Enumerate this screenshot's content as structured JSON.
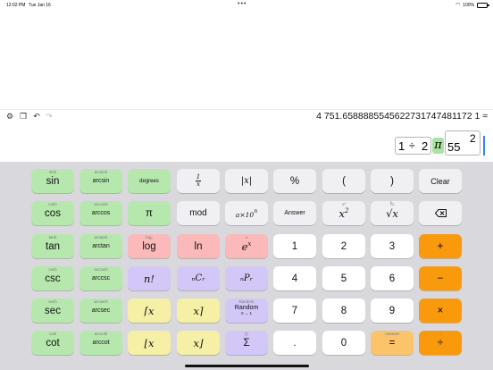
{
  "status_bar": {
    "time": "12:02 PM",
    "date": "Tue Jan 16",
    "battery": "100%"
  },
  "toolbar": {
    "result": "4 751.6588885545622731747481172 1 ≈"
  },
  "expression": {
    "t1": "1",
    "op": "÷",
    "t2": "2",
    "pi": "π",
    "base": "55",
    "exponent": "2"
  },
  "keys": {
    "sin": "sin",
    "sinh": "sinh",
    "arcsin": "arcsin",
    "arcsinh": "arcsinh",
    "cos": "cos",
    "cosh": "cosh",
    "arccos": "arccos",
    "arccosh": "arccosh",
    "tan": "tan",
    "tanh": "tanh",
    "arctan": "arctan",
    "arctanh": "arctanh",
    "csc": "csc",
    "csch": "csch",
    "arccsc": "arccsc",
    "arccsch": "arccsch",
    "sec": "sec",
    "sech": "sech",
    "arcsec": "arcsec",
    "arcsech": "arcsech",
    "cot": "cot",
    "coth": "coth",
    "arccot": "arccot",
    "arccoth": "arccoth",
    "degrees": "degrees",
    "pi": "π",
    "mod": "mod",
    "log": "log",
    "log_sub": "log₂",
    "ln": "ln",
    "factorial": "n!",
    "ncr": "ₙCᵣ",
    "npr": "ₙPᵣ",
    "ceil": "⌈x",
    "ceil_r": "x⌉",
    "floor": "⌊x",
    "floor_r": "x⌋",
    "random": "Random",
    "random_range": "0 → 1",
    "random_sub": "Random",
    "sum": "Σ",
    "sum_sub": "∏",
    "recip_num": "1",
    "recip_den": "x",
    "abs": "|x|",
    "sci_base": "a×10",
    "sci_exp": "n",
    "square_base": "x",
    "square_exp": "2",
    "square_sub": "x³",
    "sqrt": "√x",
    "sqrt_sub": "∛x",
    "exp_base": "e",
    "exp_exp": "x",
    "exp_sub": "x",
    "percent": "%",
    "lparen": "(",
    "rparen": ")",
    "answer": "Answer",
    "clear": "Clear",
    "d1": "1",
    "d2": "2",
    "d3": "3",
    "d4": "4",
    "d5": "5",
    "d6": "6",
    "d7": "7",
    "d8": "8",
    "d9": "9",
    "d0": "0",
    "dot": ".",
    "plus": "+",
    "minus": "−",
    "times": "×",
    "divide": "÷",
    "divide_sub": "÷",
    "equals": "=",
    "equals_sub": "≈answer"
  }
}
